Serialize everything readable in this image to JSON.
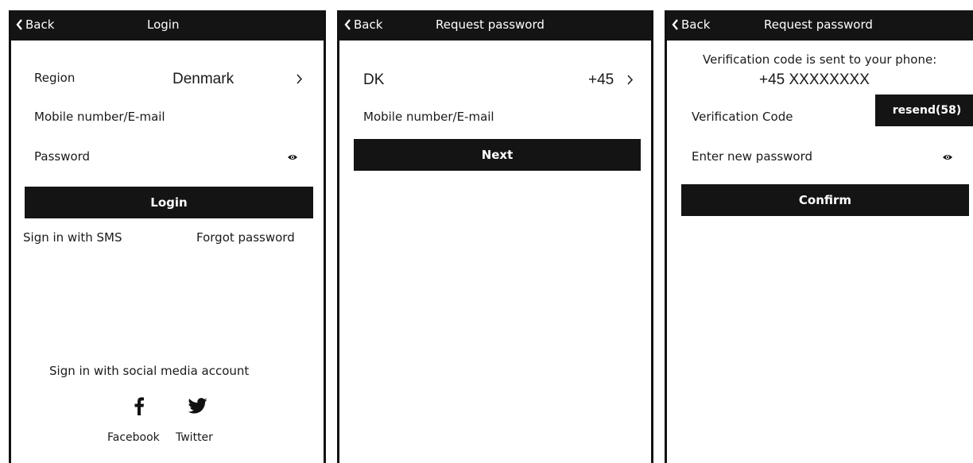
{
  "login_screen": {
    "back_label": "Back",
    "title": "Login",
    "region_label": "Region",
    "region_value": "Denmark",
    "mobile_label": "Mobile number/E-mail",
    "password_label": "Password",
    "login_button": "Login",
    "sms_link": "Sign in with SMS",
    "forgot_link": "Forgot password",
    "social_heading": "Sign in with social media account",
    "facebook_label": "Facebook",
    "twitter_label": "Twitter"
  },
  "request_screen": {
    "back_label": "Back",
    "title": "Request password",
    "country_code": "DK",
    "dial_code": "+45",
    "mobile_label": "Mobile number/E-mail",
    "next_button": "Next"
  },
  "verify_screen": {
    "back_label": "Back",
    "title": "Request password",
    "sent_message": "Verification code is sent to your phone:",
    "phone_number": "+45 XXXXXXXX",
    "code_label": "Verification Code",
    "resend_button": "resend(58)",
    "new_password_label": "Enter new password",
    "confirm_button": "Confirm"
  },
  "icons": [
    "back-chevron-icon",
    "chevron-right-icon",
    "eye-icon",
    "facebook-icon",
    "twitter-icon"
  ],
  "colors": {
    "bar": "#141414",
    "background": "#ffffff"
  }
}
